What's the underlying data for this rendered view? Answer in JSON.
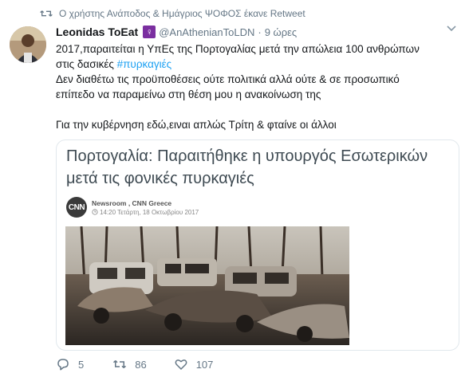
{
  "retweet_context": "Ο χρήστης Ανάποδος & Ημάγριος ΨΟΦΟΣ έκανε Retweet",
  "author": {
    "name": "Leonidas ToEat",
    "badge": "♀",
    "handle": "@AnAthenianToLDN",
    "time": "9 ώρες"
  },
  "tweet": {
    "line1": "2017,παραιτείται η ΥπΕς της Πορτογαλίας μετά την απώλεια 100 ανθρώπων",
    "line2_prefix": "στις δασικές ",
    "hashtag": "#πυρκαγιές",
    "line3": "Δεν διαθέτω τις προϋποθέσεις ούτε πολιτικά αλλά ούτε & σε προσωπικό",
    "line4": "επίπεδο να παραμείνω στη θέση μου η ανακοίνωση της",
    "line5": "Για την κυβέρνηση εδώ,ειναι απλώς Τρίτη & φταίνε οι άλλοι"
  },
  "card": {
    "title_line1": "Πορτογαλία: Παραιτήθηκε η υπουργός Εσωτερικών",
    "title_line2": "μετά τις φονικές πυρκαγιές",
    "logo_text": "CNN",
    "source": "Newsroom , CNN Greece",
    "date": "14:20 Τετάρτη, 18 Οκτωβρίου 2017"
  },
  "actions": {
    "replies": "5",
    "retweets": "86",
    "likes": "107"
  },
  "colors": {
    "link": "#1da1f2",
    "muted": "#657786",
    "badge": "#7b2fa0"
  }
}
